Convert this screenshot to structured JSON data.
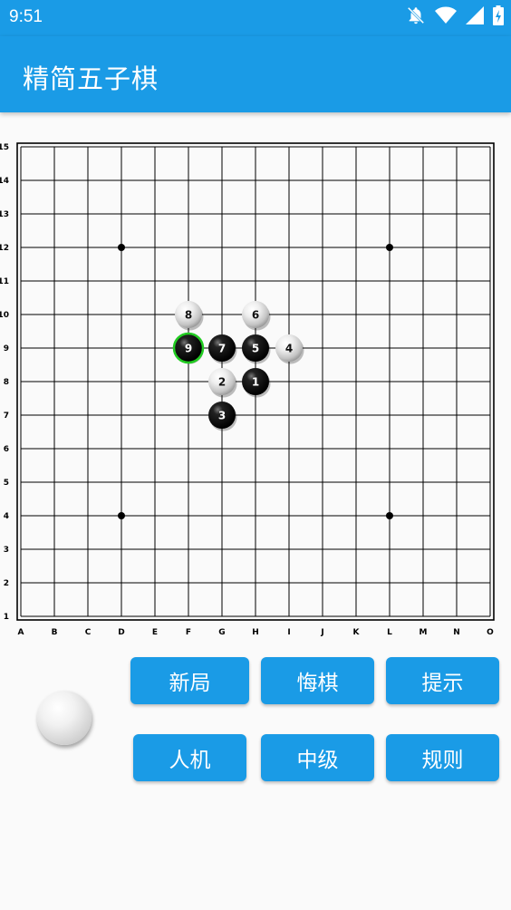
{
  "status_bar": {
    "time": "9:51",
    "icons": [
      "notifications-off-icon",
      "wifi-icon",
      "signal-icon",
      "battery-charging-icon"
    ]
  },
  "app_bar": {
    "title": "精简五子棋"
  },
  "board": {
    "size": 15,
    "columns": [
      "A",
      "B",
      "C",
      "D",
      "E",
      "F",
      "G",
      "H",
      "I",
      "J",
      "K",
      "L",
      "M",
      "N",
      "O"
    ],
    "rows": [
      "1",
      "2",
      "3",
      "4",
      "5",
      "6",
      "7",
      "8",
      "9",
      "10",
      "11",
      "12",
      "13",
      "14",
      "15"
    ],
    "star_points": [
      [
        "D",
        12
      ],
      [
        "L",
        12
      ],
      [
        "D",
        4
      ],
      [
        "L",
        4
      ]
    ],
    "moves": [
      {
        "num": "1",
        "color": "black",
        "col": "H",
        "row": 8
      },
      {
        "num": "2",
        "color": "white",
        "col": "G",
        "row": 8
      },
      {
        "num": "3",
        "color": "black",
        "col": "G",
        "row": 7
      },
      {
        "num": "4",
        "color": "white",
        "col": "I",
        "row": 9
      },
      {
        "num": "5",
        "color": "black",
        "col": "H",
        "row": 9
      },
      {
        "num": "6",
        "color": "white",
        "col": "H",
        "row": 10
      },
      {
        "num": "7",
        "color": "black",
        "col": "G",
        "row": 9
      },
      {
        "num": "8",
        "color": "white",
        "col": "F",
        "row": 10
      },
      {
        "num": "9",
        "color": "black",
        "col": "F",
        "row": 9
      }
    ],
    "last_move": "9",
    "last_move_highlight_color": "#22cc22"
  },
  "turn_indicator": {
    "color": "white"
  },
  "buttons": {
    "new_game": "新局",
    "undo": "悔棋",
    "hint": "提示",
    "vs_ai": "人机",
    "level": "中级",
    "rules": "规则"
  },
  "colors": {
    "primary": "#1a9be6",
    "background": "#fafafa"
  }
}
